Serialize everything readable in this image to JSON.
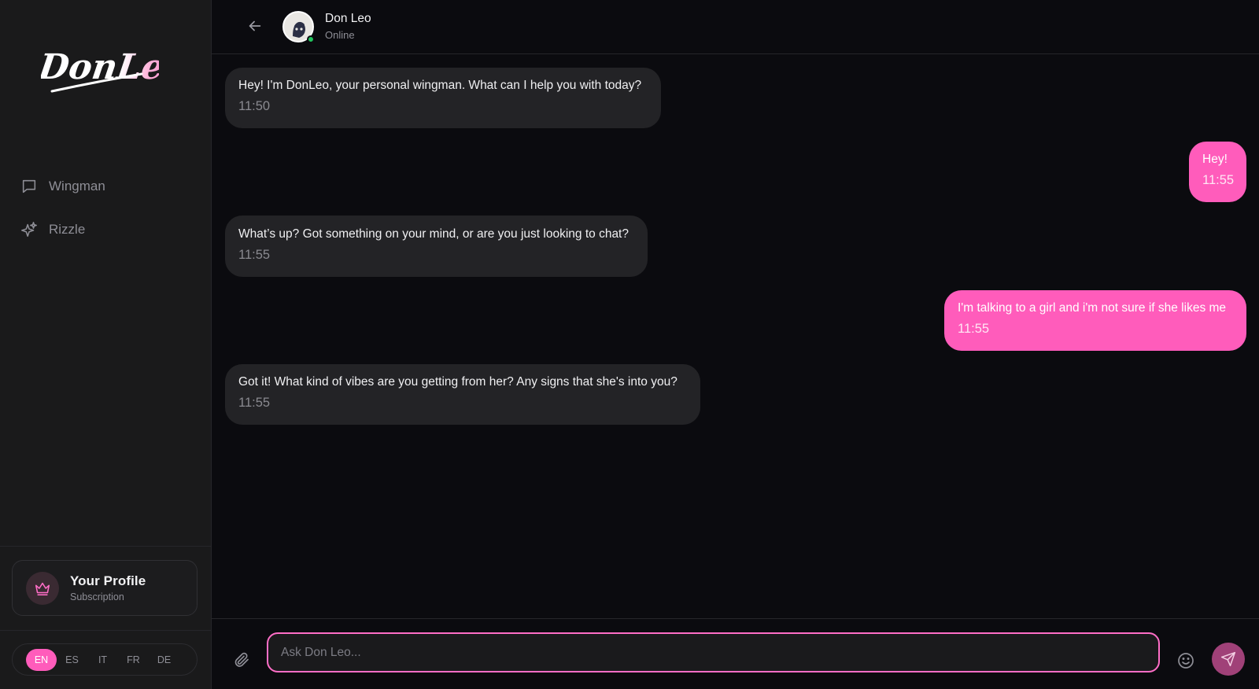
{
  "brand": {
    "logo_text": "DonLeo",
    "accent": "#ff5cbb"
  },
  "sidebar": {
    "items": [
      {
        "label": "Wingman",
        "icon": "chat-bubble-icon"
      },
      {
        "label": "Rizzle",
        "icon": "sparkles-icon"
      }
    ],
    "profile": {
      "title": "Your Profile",
      "subtitle": "Subscription",
      "icon": "crown-icon"
    },
    "languages": [
      "EN",
      "ES",
      "IT",
      "FR",
      "DE"
    ],
    "active_language": "EN"
  },
  "header": {
    "name": "Don Leo",
    "status": "Online"
  },
  "messages": [
    {
      "from": "bot",
      "text": "Hey! I'm DonLeo, your personal wingman. What can I help you with today?",
      "time": "11:50"
    },
    {
      "from": "user",
      "text": "Hey!",
      "time": "11:55"
    },
    {
      "from": "bot",
      "text": "What’s up? Got something on your mind, or are you just looking to chat?",
      "time": "11:55"
    },
    {
      "from": "user",
      "text": "I'm talking to a girl and i'm not sure if she likes me",
      "time": "11:55"
    },
    {
      "from": "bot",
      "text": "Got it! What kind of vibes are you getting from her? Any signs that she's into you?",
      "time": "11:55"
    }
  ],
  "composer": {
    "placeholder": "Ask Don Leo...",
    "value": ""
  }
}
